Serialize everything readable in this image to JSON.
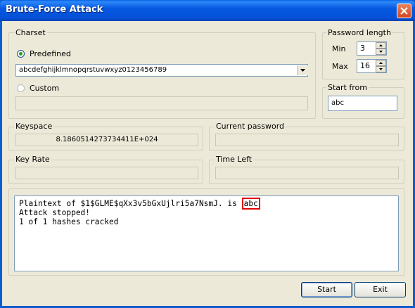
{
  "window": {
    "title": "Brute-Force Attack",
    "close_glyph": "✕"
  },
  "charset": {
    "group_label": "Charset",
    "predefined_label": "Predefined",
    "predefined_selected": true,
    "predefined_value": "abcdefghijklmnopqrstuvwxyz0123456789",
    "dropdown_glyph": "▾",
    "custom_label": "Custom",
    "custom_value": ""
  },
  "password_length": {
    "group_label": "Password length",
    "min_label": "Min",
    "min_value": "3",
    "max_label": "Max",
    "max_value": "16",
    "up_glyph": "▴",
    "down_glyph": "▾"
  },
  "start_from": {
    "group_label": "Start from",
    "value": "abc"
  },
  "keyspace": {
    "group_label": "Keyspace",
    "value": "8.1860514273734411E+024"
  },
  "current_password": {
    "group_label": "Current password",
    "value": ""
  },
  "key_rate": {
    "group_label": "Key Rate",
    "value": ""
  },
  "time_left": {
    "group_label": "Time Left",
    "value": ""
  },
  "log": {
    "line1_prefix": "Plaintext of $1$GLME$qXx3v5bGxUjlri5a7NsmJ. is ",
    "line1_highlight": "abc",
    "line2": "Attack stopped!",
    "line3": "1 of 1 hashes cracked"
  },
  "buttons": {
    "start_label": "Start",
    "exit_label": "Exit"
  },
  "colors": {
    "titlebar": "#0554e0",
    "highlight_border": "#e00000",
    "dialog_bg": "#ece9d8"
  }
}
